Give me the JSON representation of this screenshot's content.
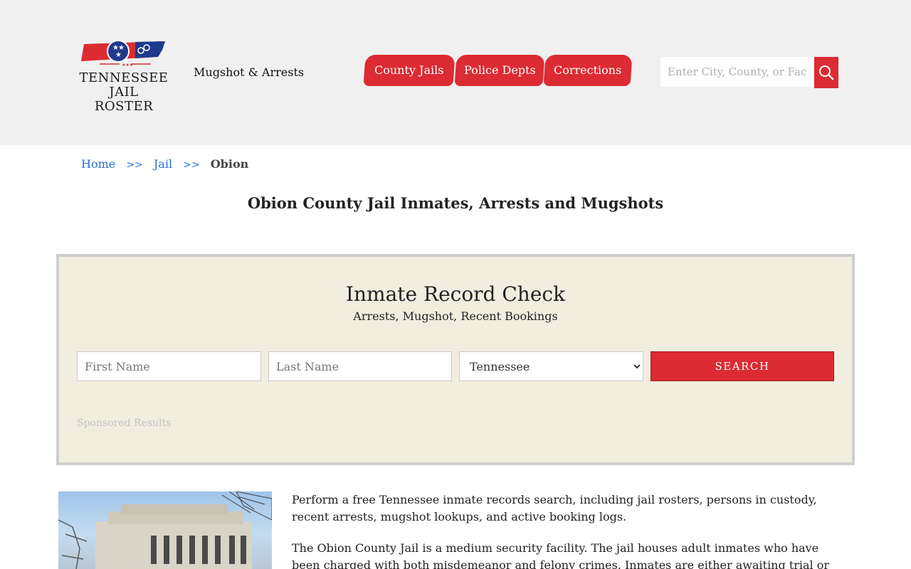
{
  "header": {
    "logo_text_line1": "TENNESSEE",
    "logo_text_line2": "JAIL ROSTER",
    "tagline": "Mugshot & Arrests",
    "nav": [
      {
        "label": "County Jails"
      },
      {
        "label": "Police Depts"
      },
      {
        "label": "Corrections"
      }
    ],
    "search_placeholder": "Enter City, County, or Facility"
  },
  "breadcrumb": {
    "home": "Home",
    "sep": ">>",
    "jail": "Jail",
    "current": "Obion"
  },
  "page_title": "Obion County Jail Inmates, Arrests and Mugshots",
  "record_check": {
    "title": "Inmate Record Check",
    "subtitle": "Arrests, Mugshot, Recent Bookings",
    "first_name_placeholder": "First Name",
    "last_name_placeholder": "Last Name",
    "state_selected": "Tennessee",
    "search_label": "SEARCH",
    "sponsored": "Sponsored Results"
  },
  "content": {
    "paragraph1": "Perform a free Tennessee inmate records search, including jail rosters, persons in custody, recent arrests, mugshot lookups, and active booking logs.",
    "paragraph2": "The Obion County Jail is a medium security facility. The jail houses adult inmates who have been charged with both misdemeanor and felony crimes. Inmates are either awaiting trial or serving their"
  },
  "colors": {
    "accent_red": "#dc2b33",
    "header_bg": "#f0f0f0",
    "panel_bg": "#f1eee0",
    "link_blue": "#2a6fd1"
  }
}
